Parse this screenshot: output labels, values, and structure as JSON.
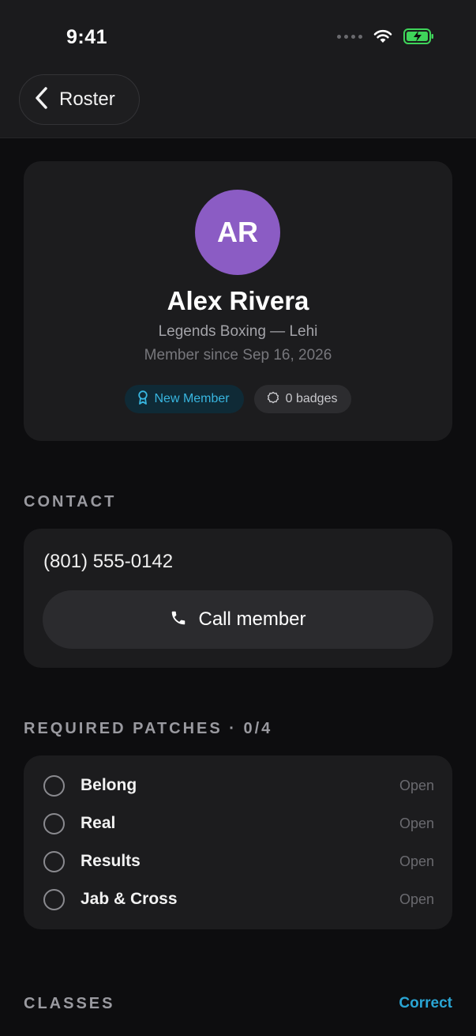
{
  "status_bar": {
    "time": "9:41"
  },
  "nav": {
    "back_label": "Roster"
  },
  "profile": {
    "initials": "AR",
    "name": "Alex Rivera",
    "gym": "Legends Boxing — Lehi",
    "member_since": "Member since Sep 16, 2026",
    "tags": {
      "status": "New Member",
      "badges": "0 badges"
    },
    "colors": {
      "avatar": "#8b5cc4",
      "status_tag": "#38b6e0"
    }
  },
  "contact": {
    "title": "CONTACT",
    "phone": "(801) 555-0142",
    "call_label": "Call member"
  },
  "patches": {
    "title": "REQUIRED PATCHES · 0/4",
    "items": [
      {
        "name": "Belong",
        "status": "Open"
      },
      {
        "name": "Real",
        "status": "Open"
      },
      {
        "name": "Results",
        "status": "Open"
      },
      {
        "name": "Jab & Cross",
        "status": "Open"
      }
    ]
  },
  "classes": {
    "title": "CLASSES",
    "action_label": "Correct"
  }
}
